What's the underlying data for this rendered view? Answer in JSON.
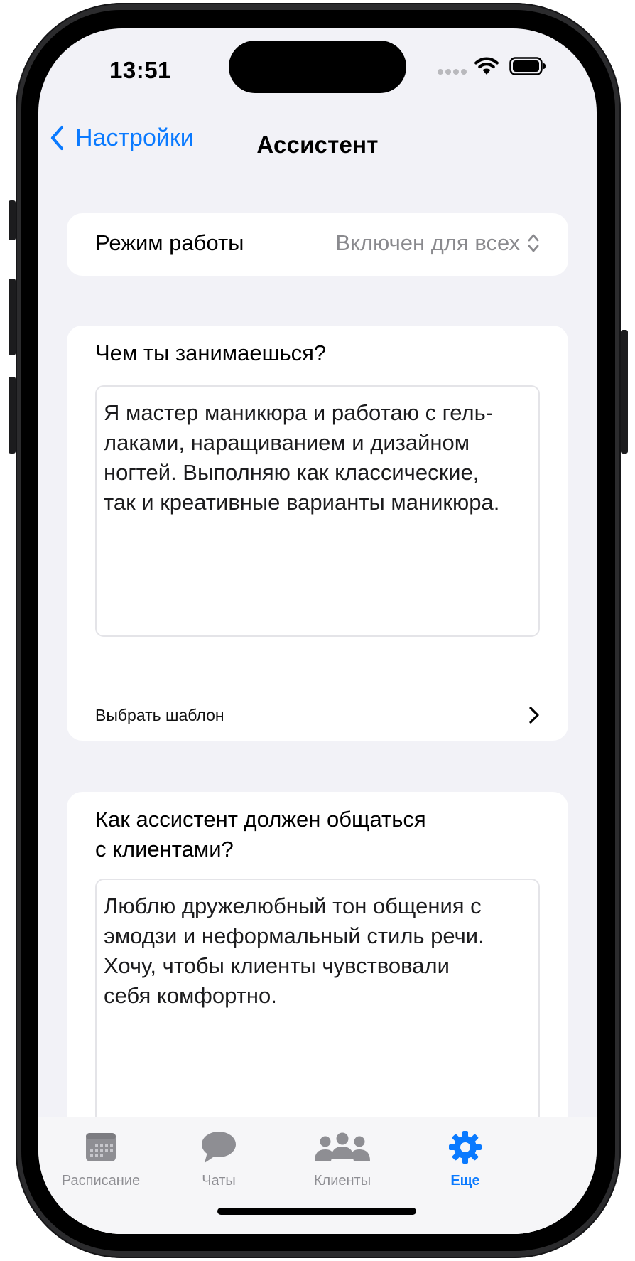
{
  "status_bar": {
    "time": "13:51"
  },
  "nav": {
    "back_label": "Настройки",
    "title": "Ассистент"
  },
  "mode": {
    "label": "Режим работы",
    "value": "Включен для всех"
  },
  "about": {
    "question": "Чем ты занимаешься?",
    "text": "Я мастер маникюра и работаю с гель-\nлаками, наращиванием и дизайном\nногтей. Выполняю как классические,\nтак и креативные варианты маникюра.",
    "template_label": "Выбрать шаблон"
  },
  "tone": {
    "question": "Как ассистент должен общаться\nс клиентами?",
    "text": "Люблю дружелюбный тон общения с\nэмодзи и неформальный стиль речи.\nХочу, чтобы клиенты чувствовали\nсебя комфортно."
  },
  "tabbar": {
    "tabs": [
      {
        "label": "Расписание",
        "icon": "calendar-icon"
      },
      {
        "label": "Чаты",
        "icon": "chat-bubble-icon"
      },
      {
        "label": "Клиенты",
        "icon": "people-icon"
      },
      {
        "label": "Еще",
        "icon": "gear-icon",
        "active": true
      }
    ]
  },
  "colors": {
    "accent": "#0a7aff",
    "inactive": "#8e8e93",
    "background": "#f2f2f7"
  }
}
